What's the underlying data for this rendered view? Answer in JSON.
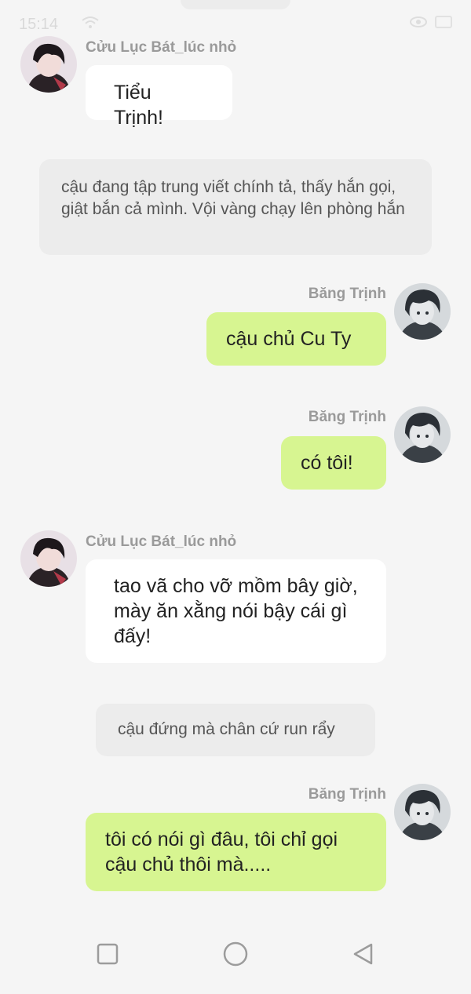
{
  "status_bar": {
    "time": "15:14",
    "icons": [
      "wifi-icon",
      "eye-icon",
      "battery-icon"
    ]
  },
  "characters": {
    "cuu": {
      "name": "Cửu Lục Bát_lúc nhỏ",
      "avatar_icon": "avatar-cuu-icon"
    },
    "bang": {
      "name": "Băng Trịnh",
      "avatar_icon": "avatar-bang-icon"
    }
  },
  "messages": [
    {
      "type": "left",
      "sender": "Cửu Lục Bát_lúc nhỏ",
      "text": "Tiểu Trịnh!"
    },
    {
      "type": "narration",
      "text": "cậu đang tập trung viết chính tả, thấy hắn gọi, giật bắn cả mình. Vội vàng chạy lên phòng hắn"
    },
    {
      "type": "right",
      "sender": "Băng Trịnh",
      "text": "cậu chủ Cu Ty"
    },
    {
      "type": "right",
      "sender": "Băng Trịnh",
      "text": "có tôi!"
    },
    {
      "type": "left",
      "sender": "Cửu Lục Bát_lúc nhỏ",
      "text": "tao vã cho vỡ mồm bây giờ, mày ăn xằng nói bậy cái gì đấy!"
    },
    {
      "type": "narration",
      "text": "cậu đứng mà chân cứ run rẩy"
    },
    {
      "type": "right",
      "sender": "Băng Trịnh",
      "text": "tôi có nói gì đâu, tôi chỉ gọi cậu chủ thôi mà....."
    }
  ],
  "nav_bar": {
    "buttons": [
      "recent-apps-icon",
      "home-icon",
      "back-icon"
    ]
  },
  "colors": {
    "background": "#f5f5f5",
    "left_bubble": "#ffffff",
    "right_bubble": "#d7f591",
    "narration_bubble": "#ececec",
    "sender_text": "#9a9a9a"
  }
}
